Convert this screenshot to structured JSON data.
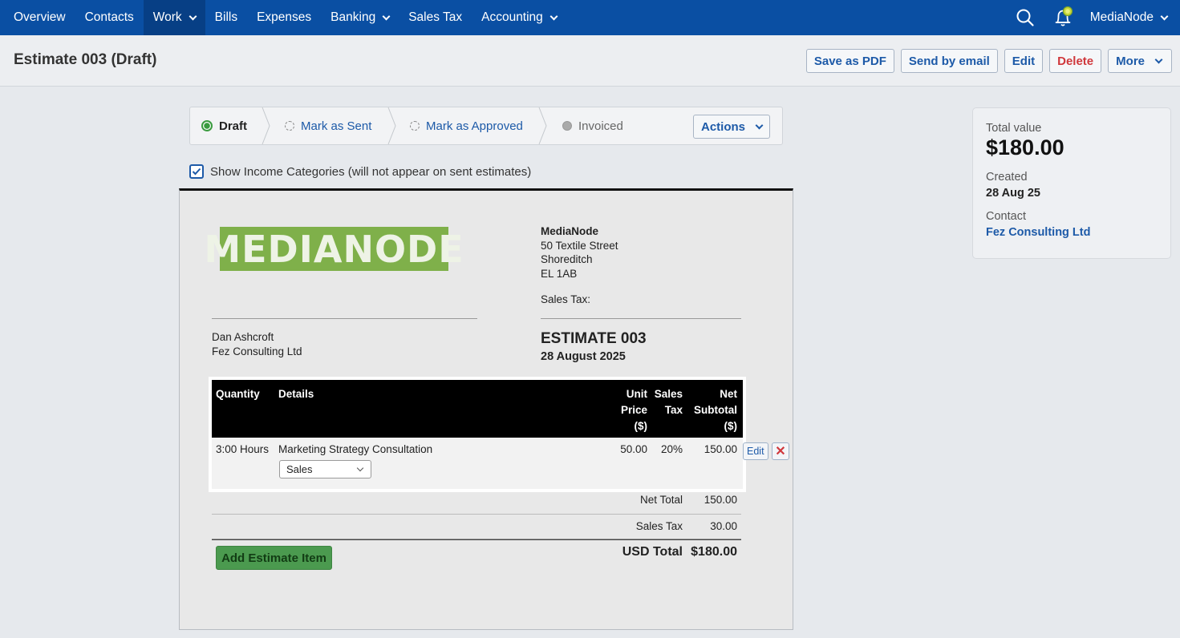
{
  "nav": {
    "items": [
      {
        "label": "Overview",
        "dropdown": false
      },
      {
        "label": "Contacts",
        "dropdown": false
      },
      {
        "label": "Work",
        "dropdown": true,
        "active": true
      },
      {
        "label": "Bills",
        "dropdown": false
      },
      {
        "label": "Expenses",
        "dropdown": false
      },
      {
        "label": "Banking",
        "dropdown": true
      },
      {
        "label": "Sales Tax",
        "dropdown": false
      },
      {
        "label": "Accounting",
        "dropdown": true
      }
    ],
    "user": "MediaNode",
    "search_icon": "search-icon",
    "notifications_icon": "bell-icon"
  },
  "header": {
    "title": "Estimate 003 (Draft)",
    "buttons": {
      "save_pdf": "Save as PDF",
      "send_email": "Send by email",
      "edit": "Edit",
      "delete": "Delete",
      "more": "More"
    }
  },
  "status": {
    "steps": [
      "Draft",
      "Mark as Sent",
      "Mark as Approved",
      "Invoiced"
    ],
    "current": "Draft",
    "actions_label": "Actions"
  },
  "income_toggle": {
    "label": "Show Income Categories (will not appear on sent estimates)",
    "checked": true
  },
  "document": {
    "logo_text": "MEDIANODE",
    "company": {
      "name": "MediaNode",
      "address": [
        "50 Textile Street",
        "Shoreditch",
        "EL 1AB"
      ],
      "sales_tax_label": "Sales Tax:"
    },
    "client": {
      "name": "Dan Ashcroft",
      "company": "Fez Consulting Ltd"
    },
    "title": "ESTIMATE 003",
    "date": "28 August 2025",
    "table": {
      "headers": {
        "quantity": "Quantity",
        "details": "Details",
        "unit_price": [
          "Unit",
          "Price",
          "($)"
        ],
        "sales_tax": [
          "Sales",
          "Tax"
        ],
        "net_subtotal": [
          "Net",
          "Subtotal",
          "($)"
        ]
      },
      "rows": [
        {
          "quantity": "3:00 Hours",
          "details": "Marketing Strategy Consultation",
          "category": "Sales",
          "unit_price": "50.00",
          "sales_tax": "20%",
          "net_subtotal": "150.00",
          "edit_label": "Edit",
          "delete_label": "✕"
        }
      ]
    },
    "totals": {
      "net_total_label": "Net Total",
      "net_total": "150.00",
      "sales_tax_label": "Sales Tax",
      "sales_tax": "30.00",
      "grand_total_label": "USD Total",
      "grand_total": "$180.00"
    },
    "add_item_label": "Add Estimate Item"
  },
  "summary": {
    "total_value_label": "Total value",
    "total_value": "$180.00",
    "created_label": "Created",
    "created": "28 Aug 25",
    "contact_label": "Contact",
    "contact": "Fez Consulting Ltd"
  },
  "colors": {
    "nav_bg": "#0a4fa3",
    "link": "#1d5aa8",
    "danger": "#d0383c",
    "draft_green": "#3a9b3f",
    "logo_green": "#7fb04a"
  }
}
